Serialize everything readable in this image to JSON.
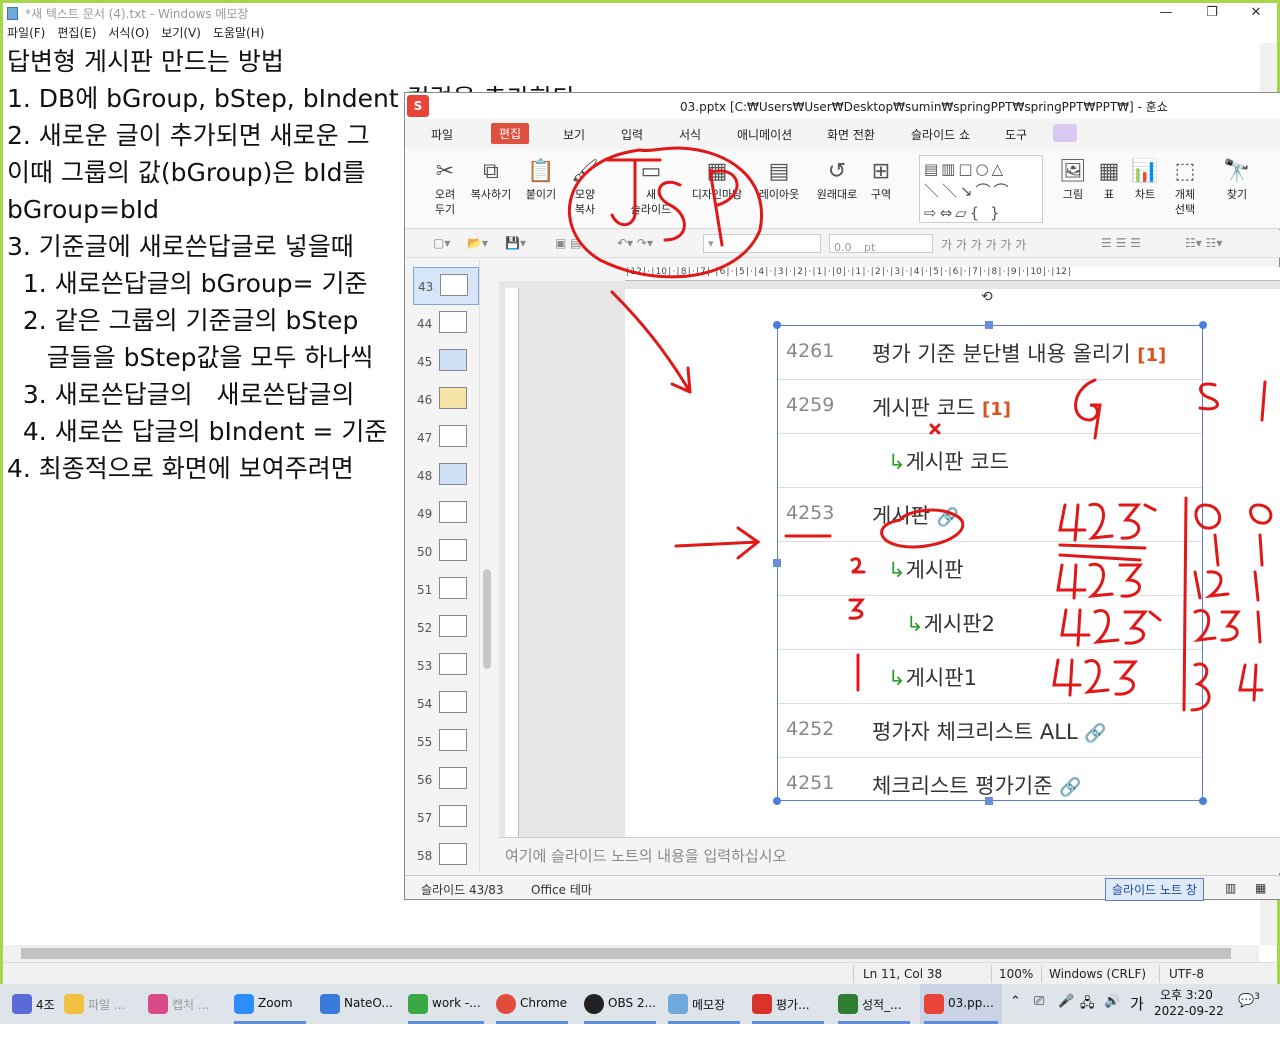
{
  "notepad": {
    "title": "*새 텍스트 문서 (4).txt - Windows 메모장",
    "menu": [
      "파일(F)",
      "편집(E)",
      "서식(O)",
      "보기(V)",
      "도움말(H)"
    ],
    "lines": [
      "답변형 게시판 만드는 방법",
      "1. DB에 bGroup, bStep, bIndent 컬럼을 추가한다",
      "2. 새로운 글이 추가되면 새로운 그",
      "이때 그룹의 값(bGroup)은 bId를",
      "bGroup=bId",
      "3. 기준글에 새로쓴답글로 넣을때",
      "  1. 새로쓴답글의 bGroup= 기준",
      "  2. 같은 그룹의 기준글의 bStep",
      "     글들을 bStep값을 모두 하나씩",
      "  3. 새로쓴답글의   새로쓴답글의",
      "  4. 새로쓴 답글의 bIndent = 기준",
      "4. 최종적으로 화면에 보여주려면"
    ],
    "status": {
      "position": "Ln 11, Col 38",
      "zoom": "100%",
      "line_ending": "Windows (CRLF)",
      "encoding": "UTF-8"
    }
  },
  "hancom": {
    "title": "03.pptx [C:₩Users₩User₩Desktop₩sumin₩springPPT₩springPPT₩PPT₩] - 훈쇼",
    "logo": "S",
    "menu": [
      "파일",
      "편집",
      "보기",
      "입력",
      "서식",
      "애니메이션",
      "화면 전환",
      "슬라이드 쇼",
      "도구"
    ],
    "active_menu": "편집",
    "ribbon": [
      {
        "label": "오려\n두기",
        "icon": "scissors-icon",
        "glyph": "✂"
      },
      {
        "label": "복사하기",
        "icon": "copy-icon",
        "glyph": "⧉"
      },
      {
        "label": "붙이기",
        "icon": "paste-icon",
        "glyph": "📋"
      },
      {
        "label": "모양\n복사",
        "icon": "format-painter-icon",
        "glyph": "🖌"
      },
      {
        "label": "새\n슬라이드",
        "icon": "new-slide-icon",
        "glyph": "▭"
      },
      {
        "label": "디자인마당",
        "icon": "design-icon",
        "glyph": "▦"
      },
      {
        "label": "레이아웃",
        "icon": "layout-icon",
        "glyph": "▤"
      },
      {
        "label": "원래대로",
        "icon": "reset-icon",
        "glyph": "↺"
      },
      {
        "label": "구역",
        "icon": "section-icon",
        "glyph": "⊞"
      },
      {
        "label": "그림",
        "icon": "picture-icon",
        "glyph": "🖼"
      },
      {
        "label": "표",
        "icon": "table-icon",
        "glyph": "▦"
      },
      {
        "label": "차트",
        "icon": "chart-icon",
        "glyph": "📊"
      },
      {
        "label": "개체\n선택",
        "icon": "select-object-icon",
        "glyph": "⬚"
      },
      {
        "label": "찾기",
        "icon": "find-icon",
        "glyph": "🔭"
      }
    ],
    "font_size": "0.0",
    "font_unit": "pt",
    "thumbnails": [
      "43",
      "44",
      "45",
      "46",
      "47",
      "48",
      "49",
      "50",
      "51",
      "52",
      "53",
      "54",
      "55",
      "56",
      "57",
      "58"
    ],
    "selected_thumbnail": "43",
    "slide_rows": [
      {
        "id": "4261",
        "title": "평가 기준 분단별 내용 올리기",
        "count": "[1]",
        "reply": false,
        "clip": false
      },
      {
        "id": "4259",
        "title": "게시판 코드",
        "count": "[1]",
        "reply": false,
        "clip": false
      },
      {
        "id": "",
        "title": "게시판 코드",
        "count": "",
        "reply": true,
        "clip": false
      },
      {
        "id": "4253",
        "title": "게시판",
        "count": "",
        "reply": false,
        "clip": true
      },
      {
        "id": "",
        "title": "게시판",
        "count": "",
        "reply": true,
        "clip": false
      },
      {
        "id": "",
        "title": "게시판2",
        "count": "",
        "reply": true,
        "clip": false
      },
      {
        "id": "",
        "title": "게시판1",
        "count": "",
        "reply": true,
        "clip": false
      },
      {
        "id": "4252",
        "title": "평가자 체크리스트 ALL",
        "count": "",
        "reply": false,
        "clip": true
      },
      {
        "id": "4251",
        "title": "체크리스트 평가기준",
        "count": "",
        "reply": false,
        "clip": true
      }
    ],
    "reply_arrow": "↳",
    "clip_icon": "🔗",
    "notes_placeholder": "여기에 슬라이드 노트의 내용을 입력하십시오",
    "status": {
      "slide": "슬라이드 43/83",
      "theme": "Office 테마",
      "notes_button": "슬라이드 노트 창"
    }
  },
  "taskbar": {
    "items": [
      {
        "label": "4조",
        "color": "#5b6bd6"
      },
      {
        "label": "파일 ...",
        "color": "#f0c040"
      },
      {
        "label": "캡처 ...",
        "color": "#d84a8a"
      },
      {
        "label": "Zoom",
        "color": "#2d8cff"
      },
      {
        "label": "NateO...",
        "color": "#3a7ad8"
      },
      {
        "label": "work -...",
        "color": "#39a845"
      },
      {
        "label": "Chrome",
        "color": "#e04b3a"
      },
      {
        "label": "OBS 2...",
        "color": "#222222"
      },
      {
        "label": "메모장",
        "color": "#6fa8dc"
      },
      {
        "label": "평가...",
        "color": "#d8342a"
      },
      {
        "label": "성적_...",
        "color": "#2e7d32"
      },
      {
        "label": "03.pp...",
        "color": "#e8443a"
      }
    ],
    "time": "오후 3:20",
    "date": "2022-09-22",
    "ime": "가",
    "notif_count": "3"
  }
}
